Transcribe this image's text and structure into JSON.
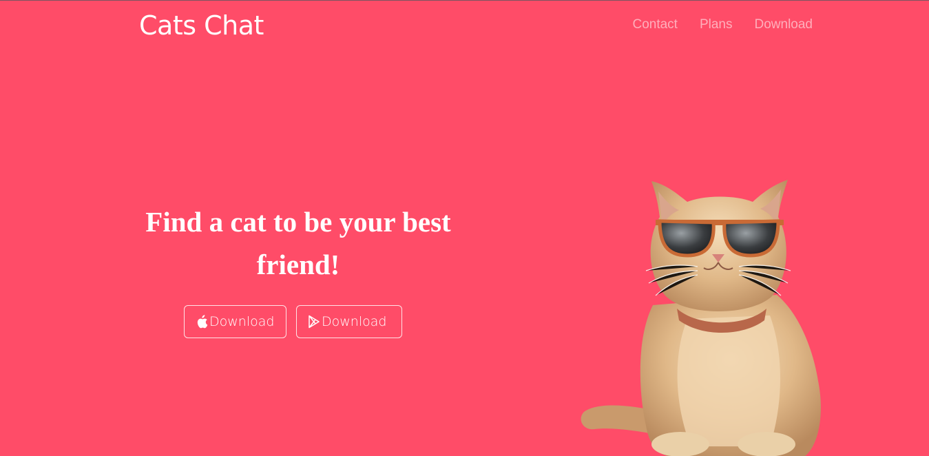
{
  "header": {
    "brand": "Cats Chat",
    "nav": [
      "Contact",
      "Plans",
      "Download"
    ]
  },
  "hero": {
    "headline": "Find a cat to be your best friend!",
    "buttons": [
      {
        "label": "Download",
        "icon": "apple-icon"
      },
      {
        "label": "Download",
        "icon": "google-play-icon"
      }
    ]
  },
  "colors": {
    "background": "#ff4c68",
    "text": "#ffffff"
  }
}
